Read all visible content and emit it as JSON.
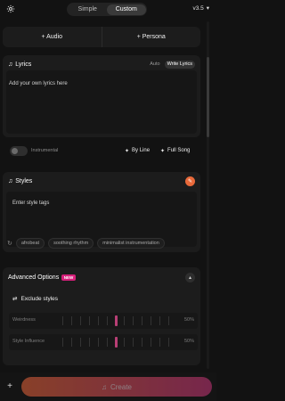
{
  "header": {
    "mode_tabs": [
      {
        "label": "Simple",
        "active": false
      },
      {
        "label": "Custom",
        "active": true
      }
    ],
    "version": "v3.5"
  },
  "add_row": {
    "audio_label": "+ Audio",
    "persona_label": "+ Persona"
  },
  "lyrics": {
    "title": "Lyrics",
    "toggle": {
      "auto": "Auto",
      "write": "Write Lyrics"
    },
    "placeholder": "Add your own lyrics here",
    "instrumental_label": "Instrumental",
    "by_line_label": "By Line",
    "full_song_label": "Full Song"
  },
  "styles": {
    "title": "Styles",
    "placeholder": "Enter style tags",
    "suggestions": [
      "afrobeat",
      "soothing rhythm",
      "minimalist instrumentation"
    ]
  },
  "advanced": {
    "title": "Advanced Options",
    "badge": "NEW",
    "exclude_label": "Exclude styles",
    "sliders": [
      {
        "label": "Weirdness",
        "value_label": "50%",
        "value": 0.5
      },
      {
        "label": "Style Influence",
        "value_label": "50%",
        "value": 0.5
      }
    ]
  },
  "footer": {
    "create_label": "Create"
  },
  "colors": {
    "accent_orange": "#e8653a",
    "accent_pink": "#c8367a",
    "badge_pink": "#d61f7a",
    "slider_thumb": "#b83f75"
  }
}
